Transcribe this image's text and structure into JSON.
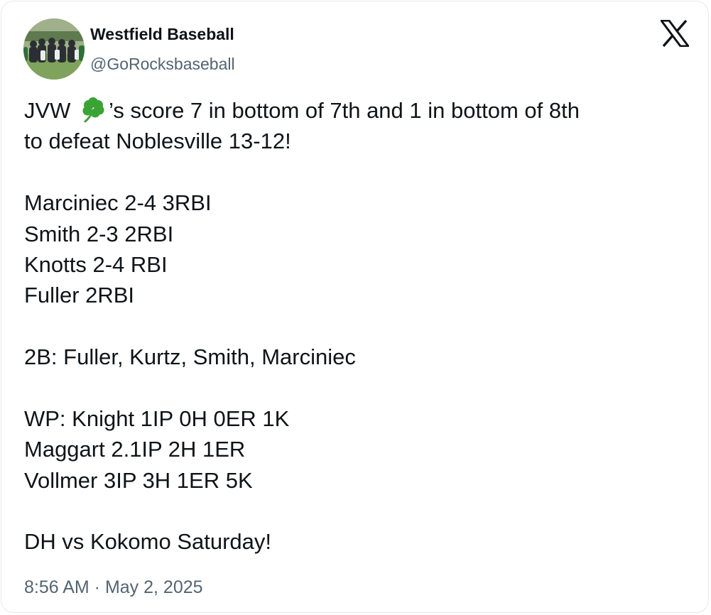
{
  "author": {
    "display_name": "Westfield Baseball",
    "handle": "@GoRocksbaseball",
    "avatar_icon": "team-photo-avatar"
  },
  "brand": {
    "logo_icon": "x-logo-icon"
  },
  "tweet": {
    "line_1_prefix": "JVW ",
    "line_1_emoji": "shamrock-icon",
    "line_1_suffix": "’s score 7 in bottom of 7th and 1 in bottom of 8th",
    "line_2": "to defeat Noblesville 13-12!",
    "batting": [
      "Marciniec 2-4 3RBI",
      "Smith 2-3 2RBI",
      "Knotts 2-4 RBI",
      "Fuller 2RBI"
    ],
    "doubles": "2B: Fuller, Kurtz, Smith, Marciniec",
    "pitching": [
      "WP: Knight 1IP 0H 0ER 1K",
      "Maggart 2.1IP 2H 1ER",
      "Vollmer 3IP 3H 1ER 5K"
    ],
    "closing": "DH vs Kokomo Saturday!"
  },
  "timestamp": "8:56 AM · May 2, 2025",
  "colors": {
    "text": "#0f1419",
    "secondary": "#536471",
    "border": "#e6e9ec",
    "shamrock": "#3aa335"
  }
}
